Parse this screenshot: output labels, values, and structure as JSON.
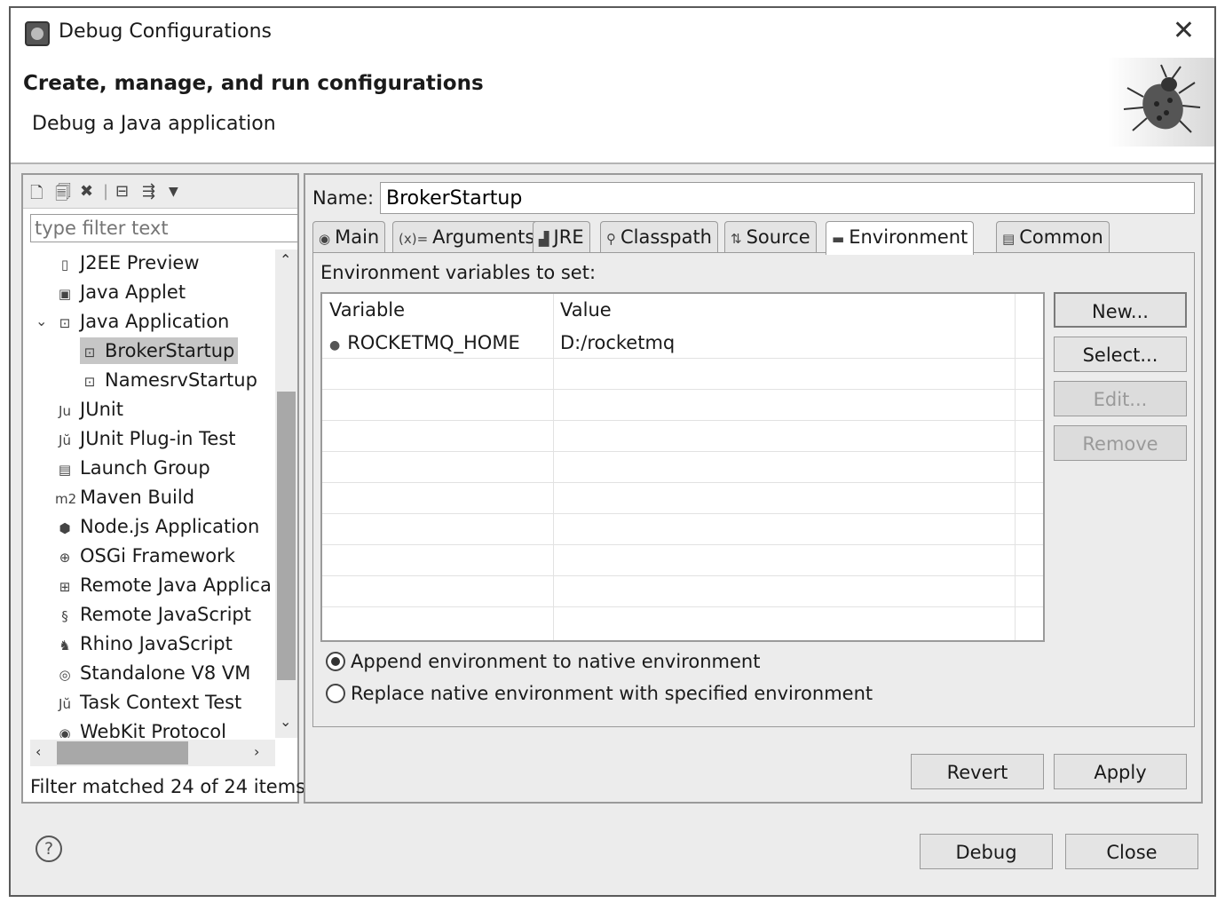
{
  "window": {
    "title": "Debug Configurations"
  },
  "header": {
    "title": "Create, manage, and run configurations",
    "description": "Debug a Java application"
  },
  "left": {
    "filter_placeholder": "type filter text",
    "tree": [
      {
        "label": "J2EE Preview",
        "icon": "j2ee-preview-icon"
      },
      {
        "label": "Java Applet",
        "icon": "java-applet-icon"
      },
      {
        "label": "Java Application",
        "icon": "java-application-icon",
        "expanded": true
      },
      {
        "label": "BrokerStartup",
        "icon": "java-config-icon",
        "selected": true
      },
      {
        "label": "NamesrvStartup",
        "icon": "java-config-icon"
      },
      {
        "label": "JUnit",
        "icon": "junit-icon"
      },
      {
        "label": "JUnit Plug-in Test",
        "icon": "junit-plugin-icon"
      },
      {
        "label": "Launch Group",
        "icon": "launch-group-icon"
      },
      {
        "label": "Maven Build",
        "icon": "maven-icon"
      },
      {
        "label": "Node.js Application",
        "icon": "nodejs-icon"
      },
      {
        "label": "OSGi Framework",
        "icon": "osgi-icon"
      },
      {
        "label": "Remote Java Applica",
        "icon": "remote-java-icon"
      },
      {
        "label": "Remote JavaScript",
        "icon": "remote-javascript-icon"
      },
      {
        "label": "Rhino JavaScript",
        "icon": "rhino-icon"
      },
      {
        "label": "Standalone V8 VM",
        "icon": "v8-icon"
      },
      {
        "label": "Task Context Test",
        "icon": "task-context-icon"
      },
      {
        "label": "WebKit Protocol",
        "icon": "webkit-icon"
      }
    ],
    "status": "Filter matched 24 of 24 items"
  },
  "config": {
    "name_label": "Name:",
    "name_value": "BrokerStartup",
    "tabs": [
      {
        "label": "Main",
        "icon": "main-tab-icon"
      },
      {
        "label": "Arguments",
        "icon": "arguments-tab-icon"
      },
      {
        "label": "JRE",
        "icon": "jre-tab-icon"
      },
      {
        "label": "Classpath",
        "icon": "classpath-tab-icon"
      },
      {
        "label": "Source",
        "icon": "source-tab-icon"
      },
      {
        "label": "Environment",
        "icon": "environment-tab-icon",
        "active": true
      },
      {
        "label": "Common",
        "icon": "common-tab-icon"
      }
    ],
    "env_label": "Environment variables to set:",
    "table_headers": [
      "Variable",
      "Value"
    ],
    "rows": [
      {
        "variable": "ROCKETMQ_HOME",
        "value": "D:/rocketmq"
      }
    ],
    "buttons": {
      "new": "New...",
      "select": "Select...",
      "edit": "Edit...",
      "remove": "Remove"
    },
    "radio_append": "Append environment to native environment",
    "radio_replace": "Replace native environment with specified environment",
    "revert": "Revert",
    "apply": "Apply"
  },
  "footer": {
    "debug": "Debug",
    "close": "Close"
  }
}
